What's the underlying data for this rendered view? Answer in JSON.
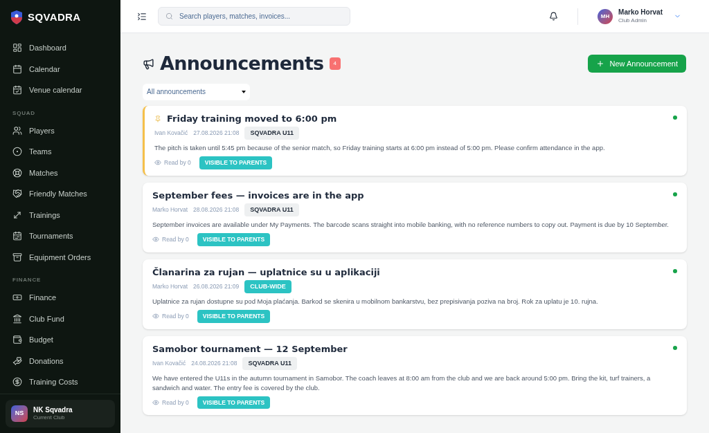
{
  "sidebar": {
    "brand": "SQVADRA",
    "sections": [
      {
        "items": [
          "Dashboard",
          "Calendar",
          "Venue calendar"
        ]
      },
      {
        "heading": "SQUAD",
        "items": [
          "Players",
          "Teams",
          "Matches",
          "Friendly Matches",
          "Trainings",
          "Tournaments",
          "Equipment Orders"
        ]
      },
      {
        "heading": "FINANCE",
        "items": [
          "Finance",
          "Club Fund",
          "Budget",
          "Donations",
          "Training Costs"
        ]
      }
    ],
    "club": {
      "initials": "NS",
      "name": "NK Sqvadra",
      "role": "Current Club"
    }
  },
  "header": {
    "search": {
      "placeholder": "Search players, matches, invoices..."
    },
    "user": {
      "initials": "MH",
      "name": "Marko Horvat",
      "role": "Club Admin"
    }
  },
  "page": {
    "title": "Announcements",
    "count": "4",
    "new_button": "New Announcement",
    "filter": "All announcements"
  },
  "announcements": [
    {
      "title": "Friday training moved to 6:00 pm",
      "pinned": true,
      "unread": true,
      "author": "Ivan Kovačić",
      "date": "27.08.2026 21:08",
      "tag": {
        "kind": "team",
        "label": "SQVADRA U11"
      },
      "body": "The pitch is taken until 5:45 pm because of the senior match, so Friday training starts at 6:00 pm instead of 5:00 pm. Please confirm attendance in the app.",
      "read": "Read by 0",
      "visibility": "VISIBLE TO PARENTS"
    },
    {
      "title": "September fees — invoices are in the app",
      "pinned": false,
      "unread": true,
      "author": "Marko Horvat",
      "date": "28.08.2026 21:08",
      "tag": {
        "kind": "team",
        "label": "SQVADRA U11"
      },
      "body": "September invoices are available under My Payments. The barcode scans straight into mobile banking, with no reference numbers to copy out. Payment is due by 10 September.",
      "read": "Read by 0",
      "visibility": "VISIBLE TO PARENTS"
    },
    {
      "title": "Članarina za rujan — uplatnice su u aplikaciji",
      "pinned": false,
      "unread": true,
      "author": "Marko Horvat",
      "date": "26.08.2026 21:09",
      "tag": {
        "kind": "club",
        "label": "CLUB-WIDE"
      },
      "body": "Uplatnice za rujan dostupne su pod Moja plaćanja. Barkod se skenira u mobilnom bankarstvu, bez prepisivanja poziva na broj. Rok za uplatu je 10. rujna.",
      "read": "Read by 0",
      "visibility": "VISIBLE TO PARENTS"
    },
    {
      "title": "Samobor tournament — 12 September",
      "pinned": false,
      "unread": true,
      "author": "Ivan Kovačić",
      "date": "24.08.2026 21:08",
      "tag": {
        "kind": "team",
        "label": "SQVADRA U11"
      },
      "body": "We have entered the U11s in the autumn tournament in Samobor. The coach leaves at 8:00 am from the club and we are back around 5:00 pm. Bring the kit, turf trainers, a sandwich and water. The entry fee is covered by the club.",
      "read": "Read by 0",
      "visibility": "VISIBLE TO PARENTS"
    }
  ]
}
